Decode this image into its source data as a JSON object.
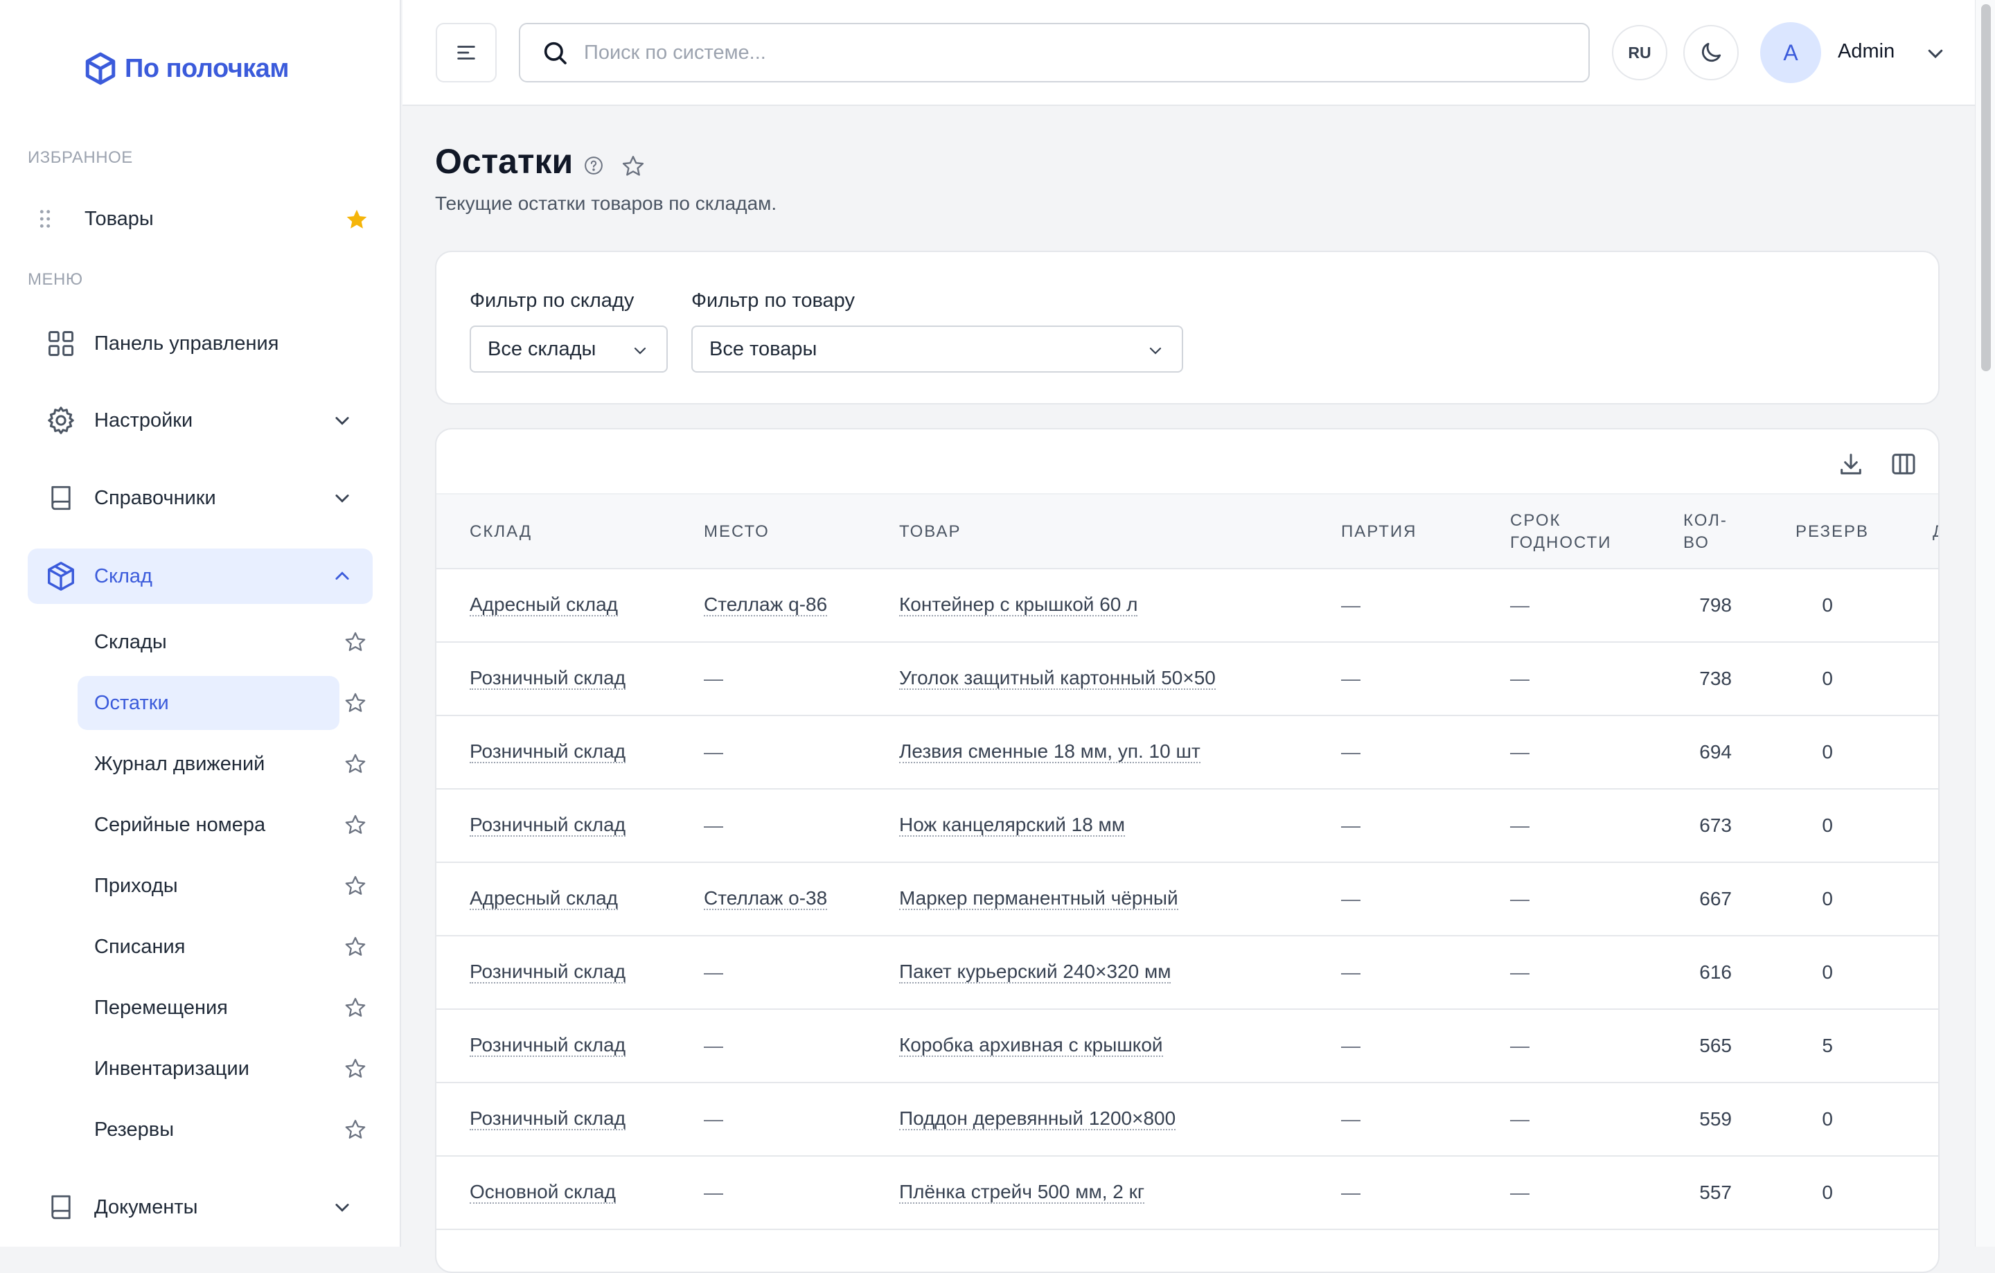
{
  "app": {
    "logo_text": "По полочкам"
  },
  "sidebar": {
    "favorites_label": "ИЗБРАННОЕ",
    "favorites": [
      {
        "label": "Товары"
      }
    ],
    "menu_label": "МЕНЮ",
    "menu": [
      {
        "label": "Панель управления",
        "icon": "dashboard-icon"
      },
      {
        "label": "Настройки",
        "icon": "gear-icon"
      },
      {
        "label": "Справочники",
        "icon": "book-icon"
      },
      {
        "label": "Склад",
        "icon": "box-icon",
        "active": true
      },
      {
        "label": "Документы",
        "icon": "book-icon"
      }
    ],
    "warehouse_items": [
      {
        "label": "Склады"
      },
      {
        "label": "Остатки",
        "active": true
      },
      {
        "label": "Журнал движений"
      },
      {
        "label": "Серийные номера"
      },
      {
        "label": "Приходы"
      },
      {
        "label": "Списания"
      },
      {
        "label": "Перемещения"
      },
      {
        "label": "Инвентаризации"
      },
      {
        "label": "Резервы"
      }
    ]
  },
  "topbar": {
    "search_placeholder": "Поиск по системе...",
    "language": "RU",
    "user_initial": "A",
    "user_name": "Admin"
  },
  "page": {
    "title": "Остатки",
    "subtitle": "Текущие остатки товаров по складам."
  },
  "filters": {
    "warehouse_label": "Фильтр по складу",
    "warehouse_value": "Все склады",
    "product_label": "Фильтр по товару",
    "product_value": "Все товары"
  },
  "table": {
    "columns": [
      "Склад",
      "Место",
      "Товар",
      "Партия",
      "Срок годности",
      "Кол-во",
      "Резерв",
      "Д"
    ],
    "rows": [
      {
        "warehouse": "Адресный склад",
        "place": "Стеллаж q-86",
        "product": "Контейнер с крышкой 60 л",
        "batch": "—",
        "expiry": "—",
        "qty": "798",
        "reserve": "0"
      },
      {
        "warehouse": "Розничный склад",
        "place": "—",
        "product": "Уголок защитный картонный 50×50",
        "batch": "—",
        "expiry": "—",
        "qty": "738",
        "reserve": "0"
      },
      {
        "warehouse": "Розничный склад",
        "place": "—",
        "product": "Лезвия сменные 18 мм, уп. 10 шт",
        "batch": "—",
        "expiry": "—",
        "qty": "694",
        "reserve": "0"
      },
      {
        "warehouse": "Розничный склад",
        "place": "—",
        "product": "Нож канцелярский 18 мм",
        "batch": "—",
        "expiry": "—",
        "qty": "673",
        "reserve": "0"
      },
      {
        "warehouse": "Адресный склад",
        "place": "Стеллаж o-38",
        "product": "Маркер перманентный чёрный",
        "batch": "—",
        "expiry": "—",
        "qty": "667",
        "reserve": "0"
      },
      {
        "warehouse": "Розничный склад",
        "place": "—",
        "product": "Пакет курьерский 240×320 мм",
        "batch": "—",
        "expiry": "—",
        "qty": "616",
        "reserve": "0"
      },
      {
        "warehouse": "Розничный склад",
        "place": "—",
        "product": "Коробка архивная с крышкой",
        "batch": "—",
        "expiry": "—",
        "qty": "565",
        "reserve": "5"
      },
      {
        "warehouse": "Розничный склад",
        "place": "—",
        "product": "Поддон деревянный 1200×800",
        "batch": "—",
        "expiry": "—",
        "qty": "559",
        "reserve": "0"
      },
      {
        "warehouse": "Основной склад",
        "place": "—",
        "product": "Плёнка стрейч 500 мм, 2 кг",
        "batch": "—",
        "expiry": "—",
        "qty": "557",
        "reserve": "0"
      }
    ]
  },
  "colors": {
    "accent": "#3b5bdb",
    "active_bg": "#e8efff",
    "favorite_star": "#f5b50a"
  }
}
